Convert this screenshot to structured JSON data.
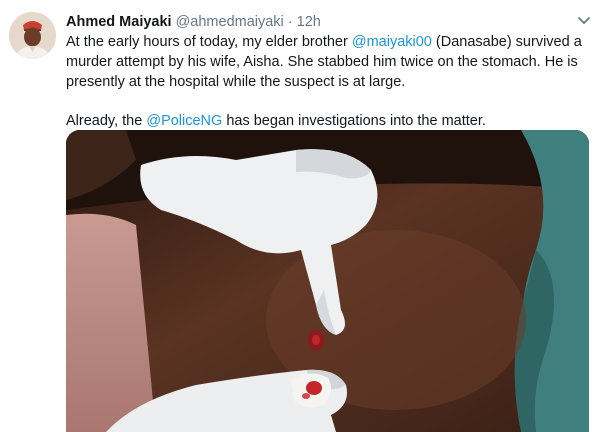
{
  "tweet": {
    "display_name": "Ahmed Maiyaki",
    "handle": "@ahmedmaiyaki",
    "separator": "·",
    "timestamp": "12h",
    "paragraph1": {
      "before_mention": "At the early hours of today, my elder brother ",
      "mention": "@maiyaki00",
      "after_mention": " (Danasabe) survived a murder attempt by his wife, Aisha. She stabbed him twice on the stomach. He is presently at the hospital while the suspect is at large."
    },
    "paragraph2": {
      "before_mention": "Already, the ",
      "mention": "@PoliceNG",
      "after_mention": " has began investigations into the matter."
    },
    "media": {
      "icon": "photo-image"
    }
  },
  "icons": {
    "more": "chevron-down-icon",
    "avatar": "profile-photo"
  },
  "colors": {
    "name": "#14171a",
    "secondary": "#657786",
    "link": "#1b95e0",
    "background": "#ffffff"
  }
}
